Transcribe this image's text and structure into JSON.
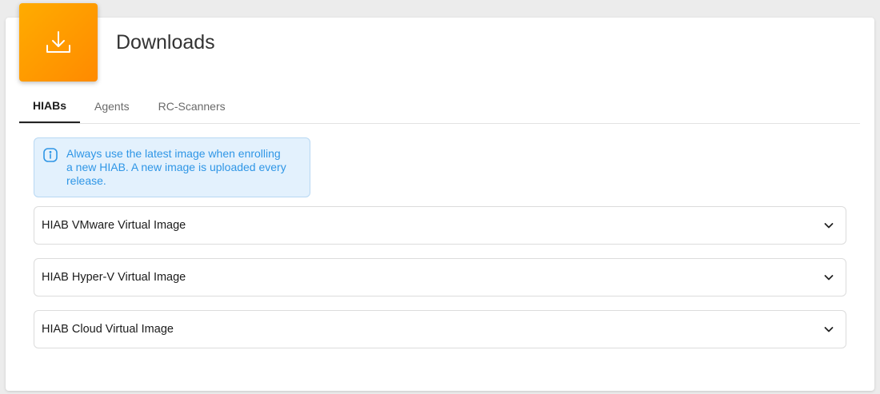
{
  "header": {
    "icon": "download-icon",
    "title": "Downloads",
    "icon_colors": [
      "#ffac00",
      "#ff8a00"
    ]
  },
  "tabs": [
    {
      "label": "HIABs",
      "active": true
    },
    {
      "label": "Agents",
      "active": false
    },
    {
      "label": "RC-Scanners",
      "active": false
    }
  ],
  "info": {
    "icon": "info-icon",
    "line1": "Always use the latest image when enrolling",
    "line2": "a new HIAB. A new image is uploaded every",
    "line3": "release."
  },
  "accordions": [
    {
      "title": "HIAB VMware Virtual Image",
      "icon": "chevron-down-icon"
    },
    {
      "title": "HIAB Hyper-V Virtual Image",
      "icon": "chevron-down-icon"
    },
    {
      "title": "HIAB Cloud Virtual Image",
      "icon": "chevron-down-icon"
    }
  ]
}
